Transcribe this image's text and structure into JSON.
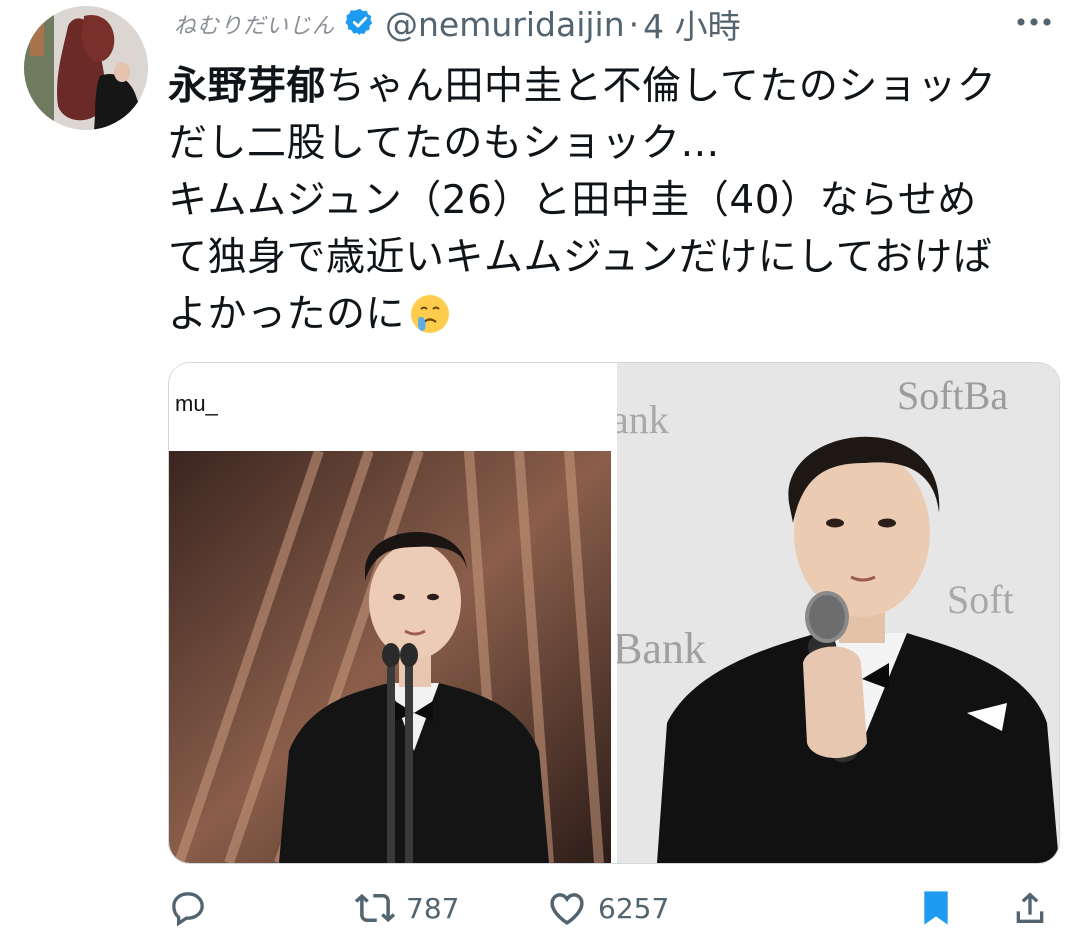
{
  "user": {
    "display_name": "ねむりだいじん",
    "handle": "@nemuridaijin",
    "separator": "·",
    "time": "4 小時"
  },
  "tweet": {
    "mention": "永野芽郁",
    "line1_rest": "ちゃん田中圭と不倫してたのショック",
    "line2": "だし二股してたのもショック…",
    "line3": "キムムジュン（26）と田中圭（40）ならせめ",
    "line4": "て独身で歳近いキムムジュンだけにしておけば",
    "line5": "よかったのに"
  },
  "media": {
    "caption": "mu_",
    "right_photo_backdrop_text_1": "SoftBa",
    "right_photo_backdrop_text_2": "ank",
    "right_photo_backdrop_text_3": "Bank",
    "right_photo_backdrop_text_4": "Soft"
  },
  "actions": {
    "retweets": "787",
    "likes": "6257"
  },
  "colors": {
    "accent": "#1d9bf0",
    "text": "#0f1419",
    "muted": "#536471"
  }
}
